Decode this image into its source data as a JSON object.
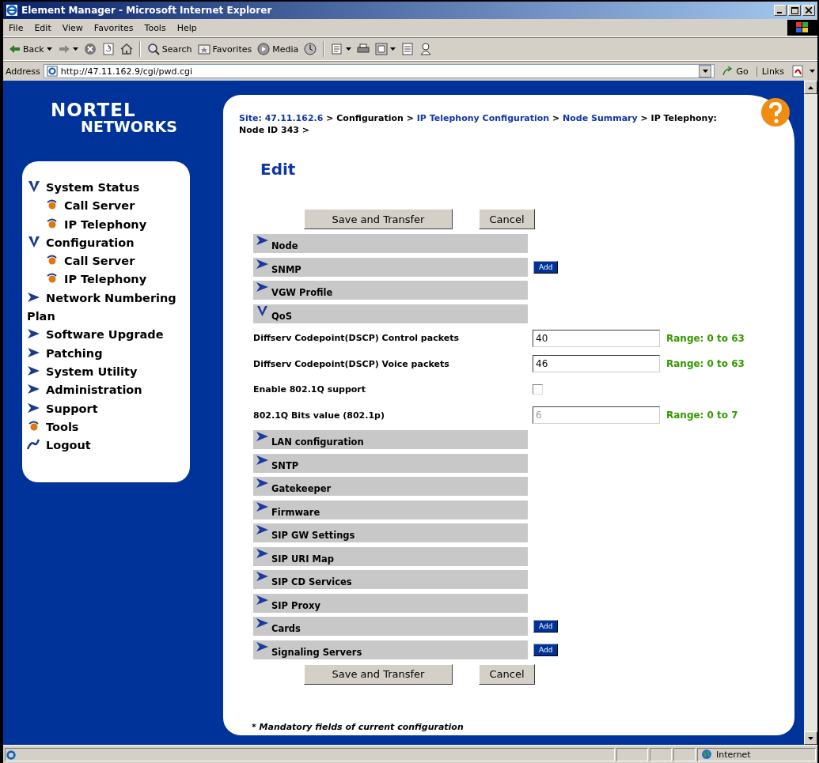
{
  "window": {
    "title": "Element Manager - Microsoft Internet Explorer"
  },
  "menu": [
    "File",
    "Edit",
    "View",
    "Favorites",
    "Tools",
    "Help"
  ],
  "toolbar": [
    {
      "kind": "back",
      "label": "Back",
      "dropdown": true
    },
    {
      "kind": "forward",
      "dropdown": true
    },
    {
      "kind": "stop"
    },
    {
      "kind": "refresh"
    },
    {
      "kind": "home"
    },
    {
      "kind": "separator"
    },
    {
      "kind": "search",
      "label": "Search"
    },
    {
      "kind": "favorites",
      "label": "Favorites"
    },
    {
      "kind": "media",
      "label": "Media"
    },
    {
      "kind": "history"
    },
    {
      "kind": "separator"
    },
    {
      "kind": "mail",
      "dropdown": true
    },
    {
      "kind": "print"
    },
    {
      "kind": "edit",
      "dropdown": true
    },
    {
      "kind": "discuss"
    },
    {
      "kind": "messenger"
    }
  ],
  "address": {
    "label": "Address",
    "url": "http://47.11.162.9/cgi/pwd.cgi",
    "go": "Go",
    "links": "Links"
  },
  "sidebar": {
    "logo_top": "NORTEL",
    "logo_bottom": "NETWORKS",
    "items": [
      {
        "label": "System Status",
        "kind": "folder",
        "expanded": true,
        "children": [
          {
            "label": "Call Server",
            "kind": "page"
          },
          {
            "label": "IP Telephony",
            "kind": "page"
          }
        ]
      },
      {
        "label": "Configuration",
        "kind": "folder",
        "expanded": true,
        "children": [
          {
            "label": "Call Server",
            "kind": "page"
          },
          {
            "label": "IP Telephony",
            "kind": "page"
          }
        ]
      },
      {
        "label": "Network Numbering Plan",
        "kind": "folder",
        "expanded": false
      },
      {
        "label": "Software Upgrade",
        "kind": "folder",
        "expanded": false
      },
      {
        "label": "Patching",
        "kind": "folder",
        "expanded": false
      },
      {
        "label": "System Utility",
        "kind": "folder",
        "expanded": false
      },
      {
        "label": "Administration",
        "kind": "folder",
        "expanded": false
      },
      {
        "label": "Support",
        "kind": "folder",
        "expanded": false
      },
      {
        "label": "Tools",
        "kind": "page"
      },
      {
        "label": "Logout",
        "kind": "logout"
      }
    ]
  },
  "breadcrumb": [
    {
      "text": "Site: 47.11.162.6",
      "kind": "link"
    },
    {
      "text": " > Configuration > ",
      "kind": "plain"
    },
    {
      "text": "IP Telephony Configuration",
      "kind": "link"
    },
    {
      "text": " > ",
      "kind": "plain"
    },
    {
      "text": "Node Summary",
      "kind": "link"
    },
    {
      "text": " > IP Telephony: Node ID 343 >",
      "kind": "plain"
    }
  ],
  "heading": "Edit",
  "top_buttons": [
    "Save and Transfer",
    "Cancel"
  ],
  "sections": [
    {
      "label": "Node",
      "expanded": false
    },
    {
      "label": "SNMP",
      "expanded": false,
      "add": "Add"
    },
    {
      "label": "VGW Profile",
      "expanded": false
    },
    {
      "label": "QoS",
      "expanded": true,
      "fields": [
        {
          "label": "Diffserv Codepoint(DSCP) Control packets",
          "kind": "text",
          "value": "40",
          "disabled": false,
          "range": "Range: 0 to 63"
        },
        {
          "label": "Diffserv Codepoint(DSCP) Voice packets",
          "kind": "text",
          "value": "46",
          "disabled": false,
          "range": "Range: 0 to 63"
        },
        {
          "label": "Enable 802.1Q support",
          "kind": "checkbox",
          "checked": false
        },
        {
          "label": "802.1Q Bits value (802.1p)",
          "kind": "text",
          "value": "6",
          "disabled": true,
          "range": "Range: 0 to 7"
        }
      ]
    },
    {
      "label": "LAN configuration",
      "expanded": false
    },
    {
      "label": "SNTP",
      "expanded": false
    },
    {
      "label": "Gatekeeper",
      "expanded": false
    },
    {
      "label": "Firmware",
      "expanded": false
    },
    {
      "label": "SIP GW Settings",
      "expanded": false
    },
    {
      "label": "SIP URI Map",
      "expanded": false
    },
    {
      "label": "SIP CD Services",
      "expanded": false
    },
    {
      "label": "SIP Proxy",
      "expanded": false
    },
    {
      "label": "Cards",
      "expanded": false,
      "add": "Add"
    },
    {
      "label": "Signaling Servers",
      "expanded": false,
      "add": "Add"
    }
  ],
  "bottom_buttons": [
    "Save and Transfer",
    "Cancel"
  ],
  "footnote": "* Mandatory fields of current configuration",
  "status_bar": {
    "zone": "Internet"
  }
}
